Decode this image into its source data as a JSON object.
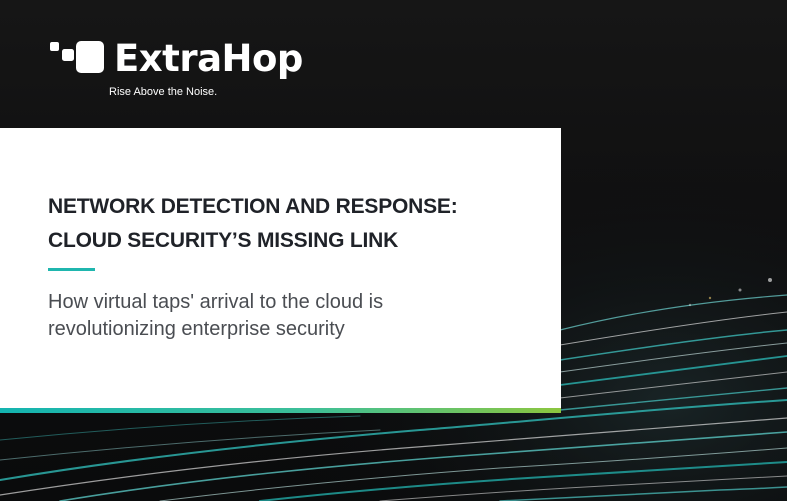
{
  "brand": {
    "name": "ExtraHop",
    "tagline": "Rise Above the Noise.",
    "logo_icon": "extrahop-logo-icon"
  },
  "cover": {
    "title_lines": [
      "NETWORK DETECTION AND RESPONSE:",
      "CLOUD SECURITY’S MISSING LINK"
    ],
    "subtitle_lines": [
      "How virtual taps' arrival to the cloud is",
      "revolutionizing enterprise security"
    ]
  },
  "colors": {
    "background": "#0f0f10",
    "card": "#ffffff",
    "accent_teal": "#1fb6ae",
    "accent_green": "#8cc63f",
    "title_text": "#1f2228",
    "subtitle_text": "#4a4d52"
  }
}
